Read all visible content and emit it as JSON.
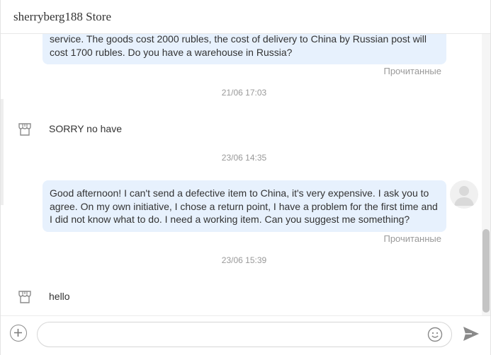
{
  "header": {
    "title": "sherryberg188 Store"
  },
  "messages": [
    {
      "type": "outgoing",
      "lines": [
        "service. The goods cost 2000 rubles, the cost of delivery to China by Russian post will",
        "cost 1700 rubles. Do you have a warehouse in Russia?"
      ],
      "status": "Прочитанные"
    },
    {
      "type": "timestamp",
      "text": "21/06 17:03"
    },
    {
      "type": "incoming",
      "text": "SORRY no have"
    },
    {
      "type": "timestamp",
      "text": "23/06 14:35"
    },
    {
      "type": "outgoing",
      "lines": [
        "Good afternoon! I can't send a defective item to China, it's very expensive. I ask you to",
        "agree. On my own initiative, I chose a return point, I have a problem for the first time and",
        "I did not know what to do. I need a working item. Can you suggest me something?"
      ],
      "status": "Прочитанные"
    },
    {
      "type": "timestamp",
      "text": "23/06 15:39"
    },
    {
      "type": "incoming",
      "text": "hello"
    }
  ],
  "composer": {
    "input_value": "",
    "placeholder": ""
  },
  "icons": {
    "store": "store-icon",
    "avatar": "user-avatar",
    "add": "plus-circle-icon",
    "emoji": "smile-icon",
    "send": "send-icon"
  },
  "colors": {
    "bubble": "#e7f1fd",
    "status_text": "#999999",
    "text": "#333333"
  }
}
